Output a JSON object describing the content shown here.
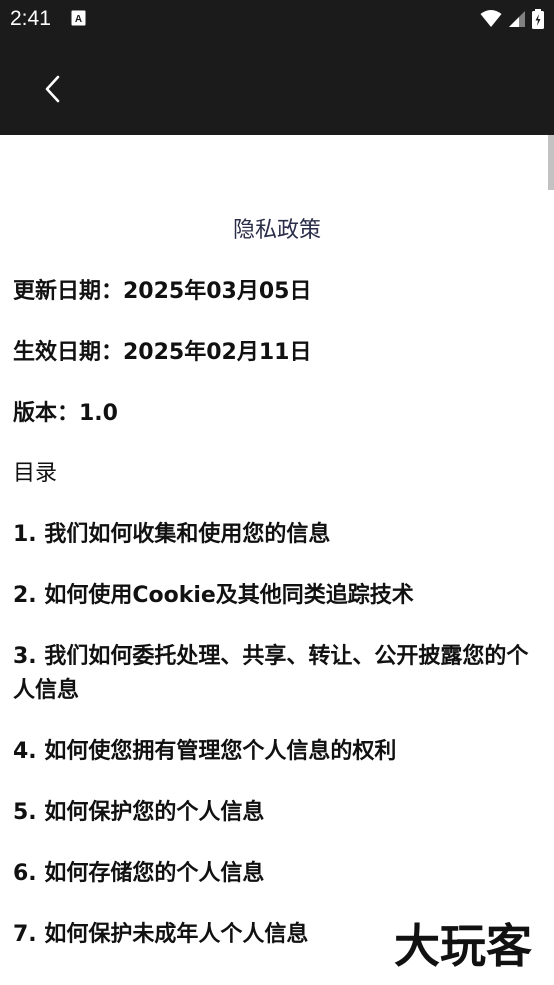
{
  "status_bar": {
    "time": "2:41",
    "app_icon_letter": "A"
  },
  "page": {
    "title": "隐私政策",
    "update_date": "更新日期：2025年03月05日",
    "effective_date": "生效日期：2025年02月11日",
    "version": "版本：1.0",
    "toc_heading": "目录",
    "toc_items": [
      "1. 我们如何收集和使用您的信息",
      "2. 如何使用Cookie及其他同类追踪技术",
      "3. 我们如何委托处理、共享、转让、公开披露您的个人信息",
      "4. 如何使您拥有管理您个人信息的权利",
      "5. 如何保护您的个人信息",
      "6. 如何存储您的个人信息",
      "7. 如何保护未成年人个人信息"
    ]
  },
  "watermark": {
    "text": "大玩客"
  },
  "colors": {
    "toolbar_bg": "#1b1b1b",
    "title_color": "#2b2e4a",
    "text_color": "#111111"
  }
}
